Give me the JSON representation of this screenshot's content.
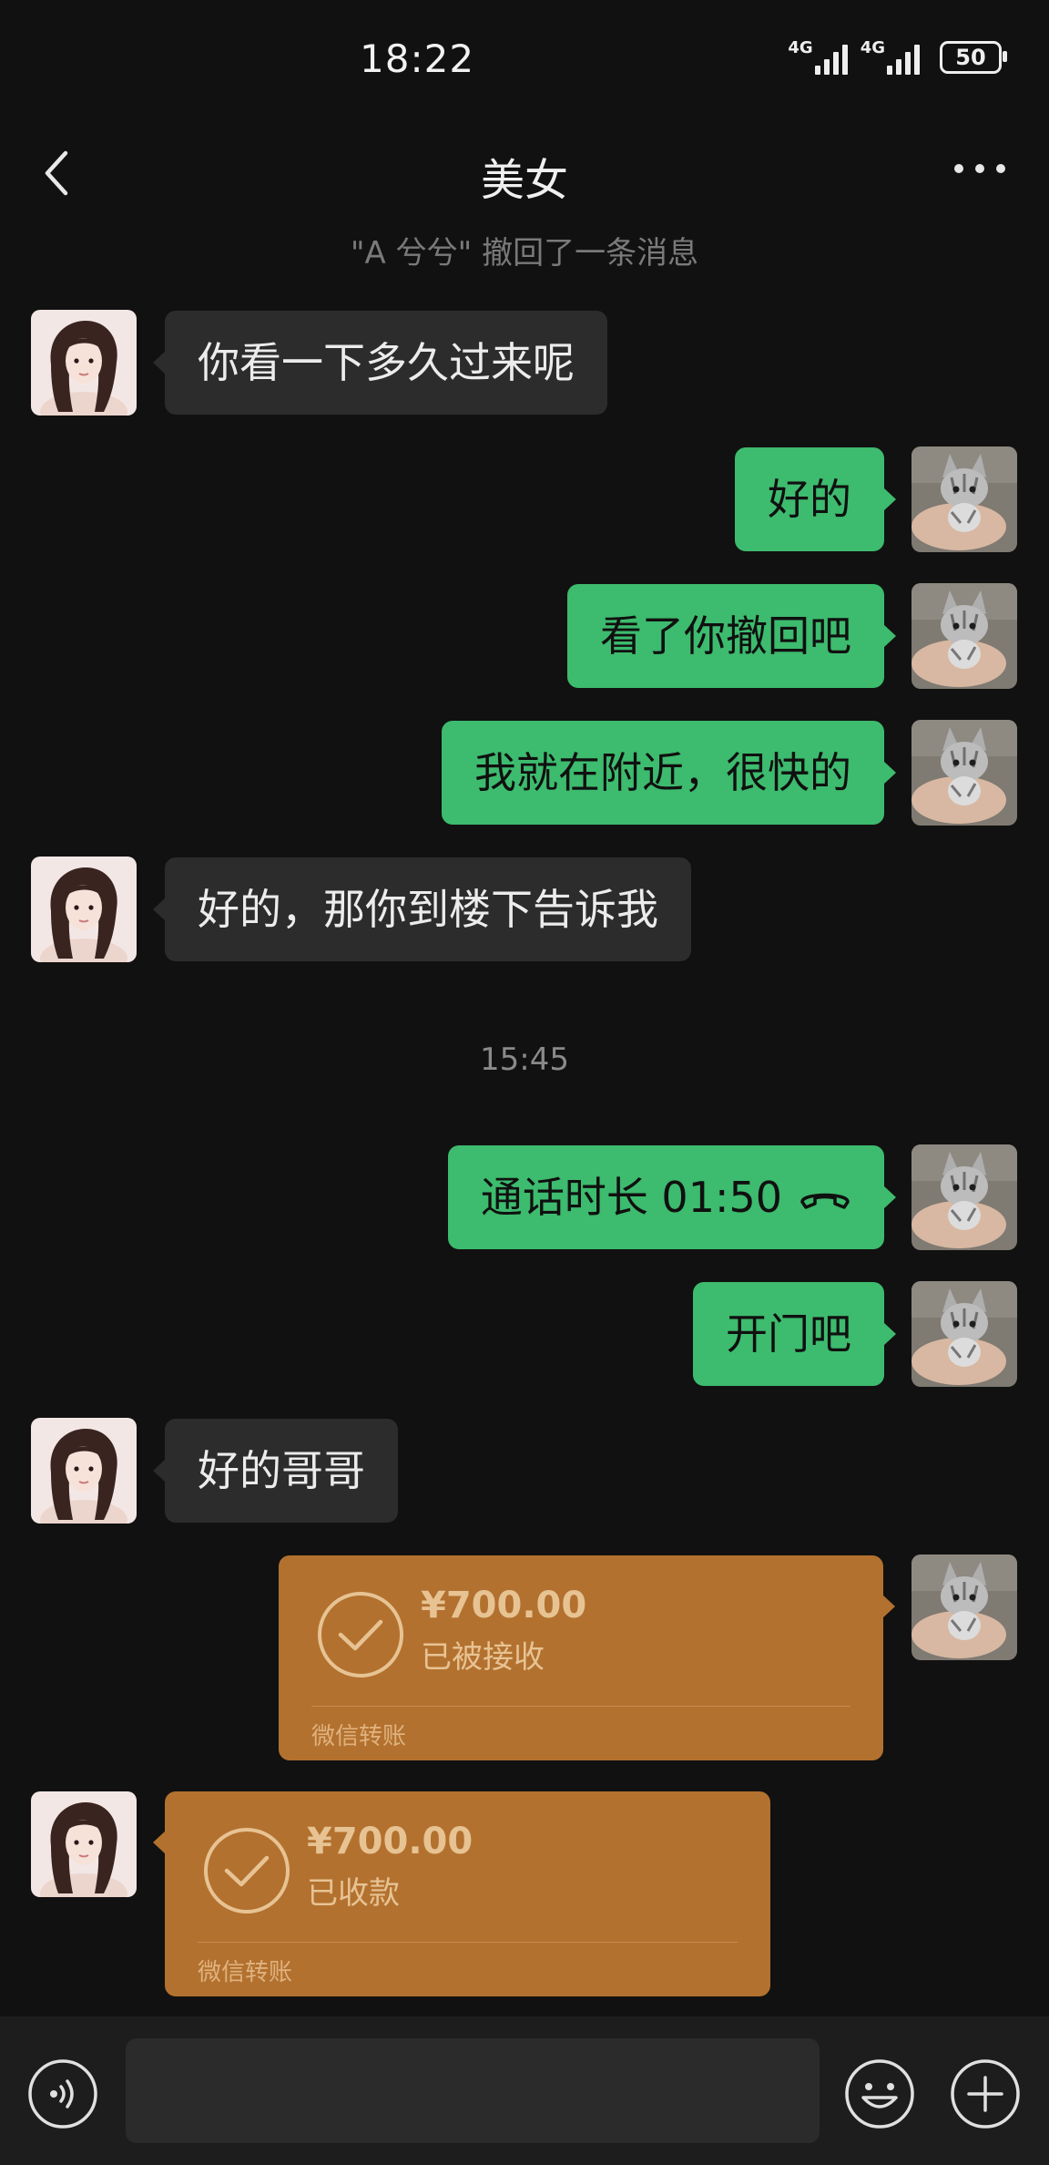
{
  "status_bar": {
    "time": "18:22",
    "network_1": "4G",
    "network_2": "4G",
    "battery": "50"
  },
  "header": {
    "title": "美女",
    "back_icon": "chevron-left-icon",
    "more_icon": "more-dots-icon"
  },
  "system_note": "\"A 兮兮\" 撤回了一条消息",
  "time_separator": "15:45",
  "messages": [
    {
      "side": "left",
      "text": "你看一下多久过来呢"
    },
    {
      "side": "right",
      "text": "好的"
    },
    {
      "side": "right",
      "text": "看了你撤回吧"
    },
    {
      "side": "right",
      "text": "我就在附近，很快的"
    },
    {
      "side": "left",
      "text": "好的，那你到楼下告诉我"
    },
    {
      "side": "right",
      "text": "通话时长 01:50",
      "icon": "phone-hangup-icon"
    },
    {
      "side": "right",
      "text": "开门吧"
    },
    {
      "side": "left",
      "text": "好的哥哥"
    }
  ],
  "transfers": [
    {
      "side": "right",
      "amount": "¥700.00",
      "status": "已被接收",
      "label": "微信转账"
    },
    {
      "side": "left",
      "amount": "¥700.00",
      "status": "已收款",
      "label": "微信转账"
    }
  ],
  "input_bar": {
    "value": "",
    "placeholder": "",
    "voice_icon": "voice-icon",
    "emoji_icon": "emoji-icon",
    "plus_icon": "plus-icon"
  },
  "colors": {
    "background": "#111111",
    "bubble_self": "#3dbb6e",
    "bubble_other": "#2c2c2c",
    "transfer": "#b3712f"
  }
}
